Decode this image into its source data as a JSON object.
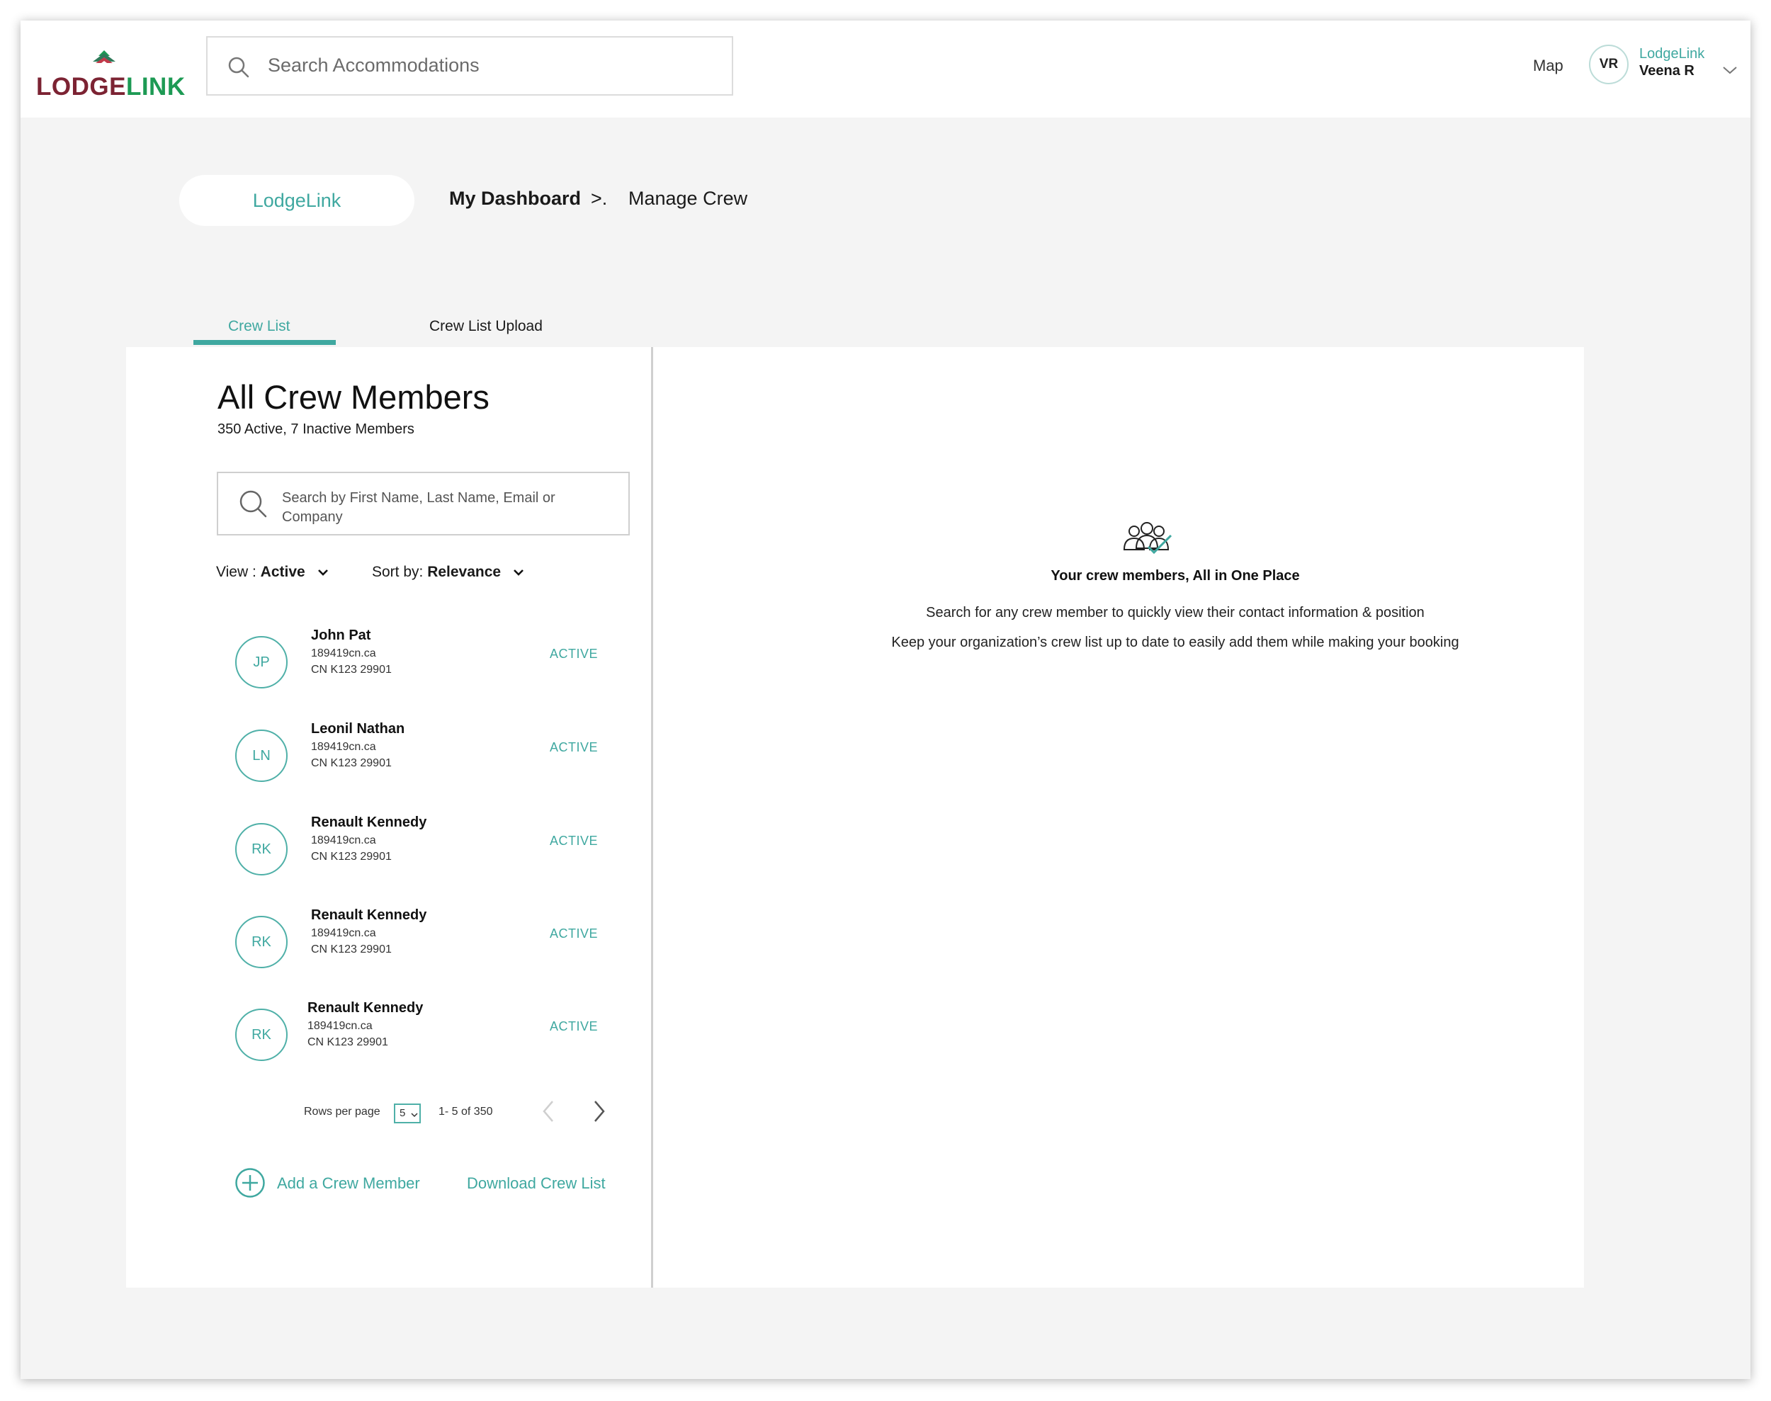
{
  "header": {
    "logo_part1": "LODGE",
    "logo_part2": "LINK",
    "search_placeholder": "Search Accommodations",
    "map_link": "Map",
    "user_initials": "VR",
    "user_org": "LodgeLink",
    "user_name": "Veena R"
  },
  "breadcrumb": {
    "home_pill": "LodgeLink",
    "item1": "My Dashboard",
    "separator": ">.",
    "item2": "Manage Crew"
  },
  "tabs": [
    {
      "label": "Crew List",
      "active": true
    },
    {
      "label": "Crew List Upload",
      "active": false
    }
  ],
  "crew_panel": {
    "title": "All Crew Members",
    "subtitle": "350 Active, 7 Inactive Members",
    "search_placeholder": "Search by First Name, Last Name, Email or Company",
    "view_label": "View : ",
    "view_value": "Active",
    "sort_label": "Sort by: ",
    "sort_value": "Relevance",
    "members": [
      {
        "initials": "JP",
        "name": "John Pat",
        "line1": "189419cn.ca",
        "line2": "CN K123 29901",
        "status": "ACTIVE"
      },
      {
        "initials": "LN",
        "name": "Leonil Nathan",
        "line1": "189419cn.ca",
        "line2": "CN K123 29901",
        "status": "ACTIVE"
      },
      {
        "initials": "RK",
        "name": "Renault Kennedy",
        "line1": "189419cn.ca",
        "line2": "CN K123 29901",
        "status": "ACTIVE"
      },
      {
        "initials": "RK",
        "name": "Renault Kennedy",
        "line1": "189419cn.ca",
        "line2": "CN K123 29901",
        "status": "ACTIVE"
      },
      {
        "initials": "RK",
        "name": "Renault Kennedy",
        "line1": "189419cn.ca",
        "line2": "CN K123 29901",
        "status": "ACTIVE"
      }
    ],
    "pager": {
      "rows_label": "Rows per page",
      "rows_value": "5",
      "range": "1- 5 of 350"
    },
    "add_member": "Add a Crew Member",
    "download": "Download Crew List"
  },
  "empty_state": {
    "icon": "crew-group-check-icon",
    "title": "Your crew members, All in One Place",
    "line1": "Search for any crew member to quickly view their contact information & position",
    "line2": "Keep your organization’s crew list up to date to easily add them while making your booking"
  },
  "colors": {
    "accent": "#3fa8a0",
    "logo_maroon": "#7c2333",
    "logo_green": "#1d9a54",
    "background": "#f4f4f4"
  }
}
